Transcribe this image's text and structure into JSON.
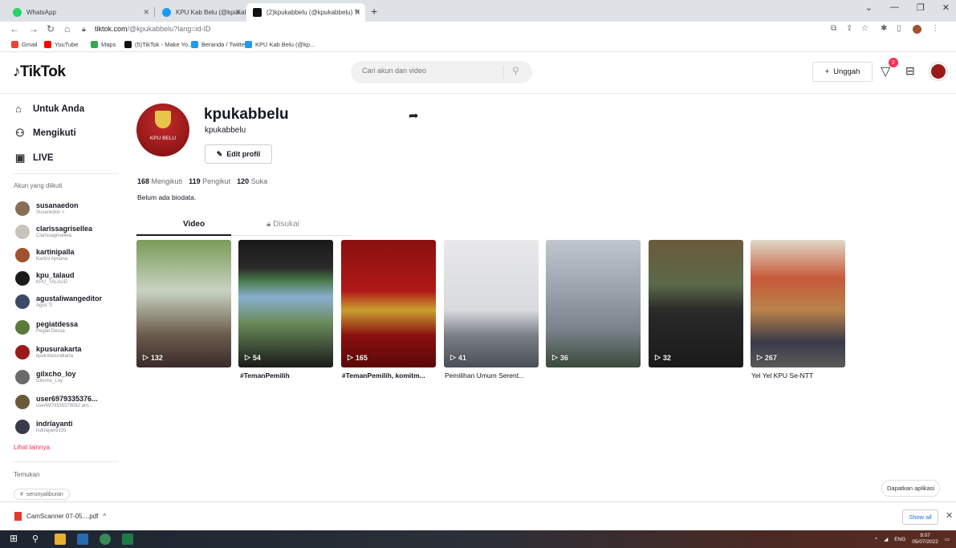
{
  "browser": {
    "tabs": [
      {
        "title": "WhatsApp",
        "color": "#25d366"
      },
      {
        "title": "KPU Kab Belu (@kpukabbelu) / T",
        "color": "#1d9bf0"
      },
      {
        "title": "(2)kpukabbelu (@kpukabbelu) Ti",
        "color": "#111111"
      }
    ],
    "url_host": "tiktok.com",
    "url_path": "/@kpukabbelu?lang=id-ID",
    "bookmarks": [
      {
        "label": "Gmail",
        "color": "#ea4335"
      },
      {
        "label": "YouTube",
        "color": "#ff0000"
      },
      {
        "label": "Maps",
        "color": "#34a853"
      },
      {
        "label": "(5)TikTok - Make Yo...",
        "color": "#111111"
      },
      {
        "label": "Beranda / Twitter",
        "color": "#1d9bf0"
      },
      {
        "label": "KPU Kab Belu (@kp...",
        "color": "#1d9bf0"
      }
    ]
  },
  "header": {
    "logo": "TikTok",
    "search_placeholder": "Cari akun dan video",
    "upload_label": "Unggah",
    "notification_count": "2"
  },
  "sidebar": {
    "nav": [
      {
        "label": "Untuk Anda",
        "icon": "home-icon"
      },
      {
        "label": "Mengikuti",
        "icon": "people-icon"
      },
      {
        "label": "LIVE",
        "icon": "live-icon"
      }
    ],
    "followed_title": "Akun yang diikuti",
    "accounts": [
      {
        "name": "susanaedon",
        "sub": "Susanedon <",
        "color": "#8a6d55"
      },
      {
        "name": "clarissagrisellea",
        "sub": "Clarissagrisellea",
        "color": "#c9c3bd"
      },
      {
        "name": "kartinipalla",
        "sub": "Kartini Apriana",
        "color": "#a0522d"
      },
      {
        "name": "kpu_talaud",
        "sub": "KPU_TALAUD",
        "color": "#1a1a1a"
      },
      {
        "name": "agustaliwangeditor",
        "sub": "Agus TI",
        "color": "#3d4a66"
      },
      {
        "name": "pegiatdessa",
        "sub": "Pegiat Dessa",
        "color": "#5a7a3a"
      },
      {
        "name": "kpusurakarta",
        "sub": "kpukotasurakarta",
        "color": "#9b1b1b"
      },
      {
        "name": "gilxcho_loy",
        "sub": "Gilxcho_Loy",
        "color": "#6a6a6a"
      },
      {
        "name": "user6979335376...",
        "sub": "user6979335376082 am...",
        "color": "#6b5a3a"
      },
      {
        "name": "indriayanti",
        "sub": "indriayanti335",
        "color": "#3a3a4a"
      }
    ],
    "see_more": "Lihat lainnya",
    "discover_title": "Temukan",
    "tag": "serunyaliburan"
  },
  "profile": {
    "username": "kpukabbelu",
    "nickname": "kpukabbelu",
    "avatar_label": "KPU BELU",
    "edit_label": "Edit profil",
    "following_count": "168",
    "following_label": "Mengikuti",
    "followers_count": "119",
    "followers_label": "Pengikut",
    "likes_count": "120",
    "likes_label": "Suka",
    "bio": "Belum ada biodata.",
    "tab_video": "Video",
    "tab_liked": "Disukai"
  },
  "videos": [
    {
      "views": "132",
      "title": ""
    },
    {
      "views": "54",
      "title": "#TemanPemilih"
    },
    {
      "views": "165",
      "title": "#TemanPemilih, komitm..."
    },
    {
      "views": "41",
      "title": "Pemilihan Umum Serent..."
    },
    {
      "views": "36",
      "title": ""
    },
    {
      "views": "32",
      "title": ""
    },
    {
      "views": "267",
      "title": "Yel Yel KPU Se-NTT"
    }
  ],
  "get_app": "Dapatkan aplikasi",
  "download": {
    "file": "CamScanner 07-05....pdf",
    "show_all": "Show all"
  },
  "taskbar": {
    "lang": "ENG",
    "time": "9:07",
    "date": "05/07/2022"
  }
}
